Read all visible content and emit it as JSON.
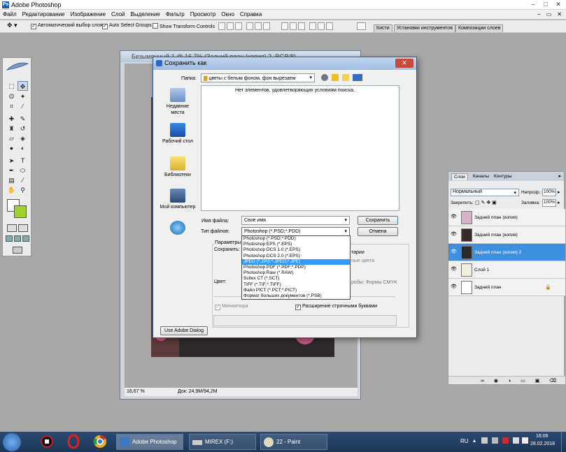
{
  "app": {
    "title": "Adobe Photoshop"
  },
  "menu": [
    "Файл",
    "Редактирование",
    "Изображение",
    "Слой",
    "Выделение",
    "Фильтр",
    "Просмотр",
    "Окно",
    "Справка"
  ],
  "options": {
    "auto_select_layer": "Автоматический выбор слоя",
    "auto_select_groups": "Auto Select Groups",
    "show_transform": "Show Transform Controls",
    "well_tabs": [
      "Кисти",
      "Установки инструментов",
      "Композиции слоев"
    ]
  },
  "document": {
    "title": "Безымянный-1 @ 16,7% (Задний план (копия) 2, RGB/8)",
    "zoom": "16,67 %",
    "doc_size": "Док: 24,9M/94,2M"
  },
  "save_dialog": {
    "title": "Сохранить как",
    "folder_label": "Папка:",
    "folder_value": "цветы с белым фоном, фон вырезаем",
    "empty_message": "Нет элементов, удовлетворяющих условиям поиска.",
    "places": [
      "Недавние места",
      "Рабочий стол",
      "Библиотеки",
      "Мой компьютер",
      ""
    ],
    "filename_label": "Имя файла:",
    "filename_value": "Свое имя",
    "filetype_label": "Тип файлов:",
    "filetype_value": "Photoshop (*.PSD;*.PDD)",
    "save_button": "Сохранить",
    "cancel_button": "Отмена",
    "params_label": "Параметры",
    "save_label": "Сохранить:",
    "annotations_partial": "тарии",
    "spot_colors_partial": "ные цвета",
    "color_label": "Цвет:",
    "proof_partial": "робы: Формы CMYK",
    "thumbnail_label": "Миниатюра",
    "lowercase_label": "Расширение строчными буквами",
    "use_adobe_dialog": "Use Adobe Dialog",
    "file_types": [
      "Photoshop (*.PSD;*.PDD)",
      "Photoshop EPS (*.EPS)",
      "Photoshop DCS 1.0 (*.EPS)",
      "Photoshop DCS 2.0 (*.EPS)",
      "JPEG (*.JPG;*.JPEG;*.JPE)",
      "Photoshop PDF (*.PDF;*.PDP)",
      "Photoshop Raw (*.RAW)",
      "Scitex CT (*.SCT)",
      "TIFF (*.TIF;*.TIFF)",
      "Файл PICT (*.PCT;*.PICT)",
      "Формат больших документов (*.PSB)"
    ],
    "selected_type_index": 4
  },
  "layers_panel": {
    "tabs": [
      "Слои",
      "Каналы",
      "Контуры"
    ],
    "blend_mode": "Нормальный",
    "opacity_label": "Непрозр.:",
    "opacity_value": "100%",
    "lock_label": "Закрепить:",
    "fill_label": "Заливка:",
    "fill_value": "100%",
    "layers": [
      {
        "name": "Задний план (копия)",
        "selected": false
      },
      {
        "name": "Задний план (копия)",
        "selected": false
      },
      {
        "name": "Задний план (копия) 2",
        "selected": true
      },
      {
        "name": "Слой 1",
        "selected": false
      },
      {
        "name": "Задний план",
        "selected": false
      }
    ]
  },
  "taskbar": {
    "tasks": [
      "Adobe Photoshop",
      "MIREX (F:)",
      "22 - Paint"
    ],
    "lang": "RU",
    "time": "16:06",
    "date": "28.02.2018"
  },
  "colors": {
    "selection": "#3399ff",
    "taskbar": "#1d3658",
    "layer_selected": "#3d8fe0"
  }
}
